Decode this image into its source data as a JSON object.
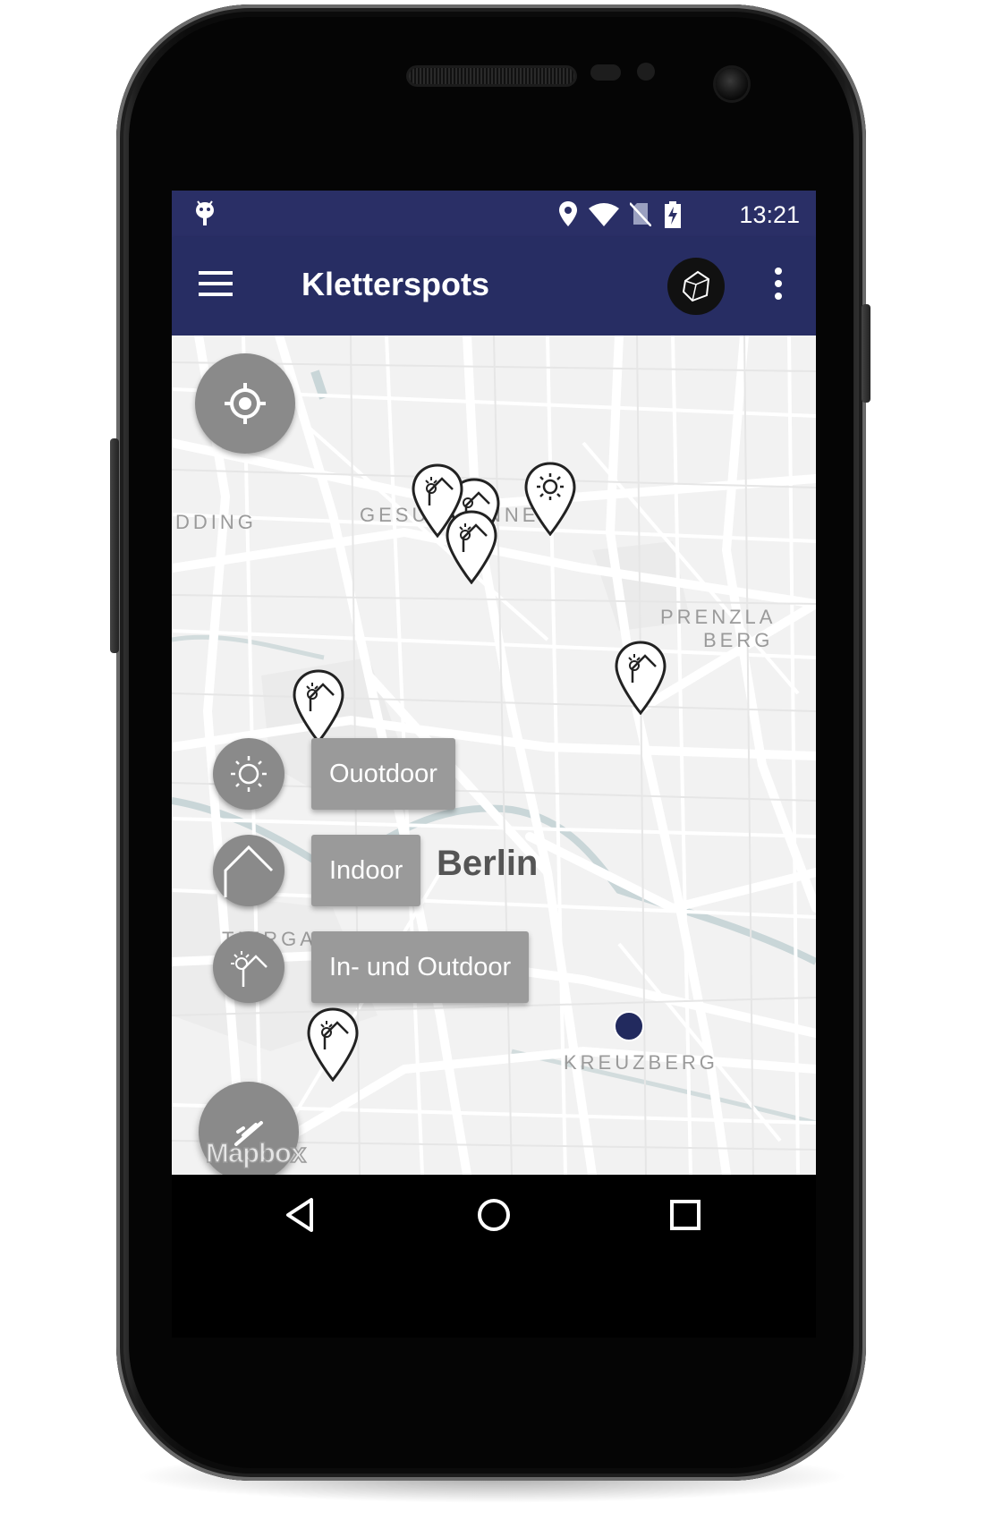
{
  "status_bar": {
    "time": "13:21",
    "icons": [
      "android-debug-icon",
      "location-icon",
      "wifi-icon",
      "no-sim-icon",
      "battery-charging-icon"
    ]
  },
  "toolbar": {
    "title": "Kletterspots",
    "menu_icon": "hamburger-menu-icon",
    "logo_icon": "boulder-logo-icon",
    "more_icon": "more-vert-icon",
    "background": "#272d63"
  },
  "map": {
    "labels": {
      "wedding": "DDING",
      "gesundbrunnen_left": "GESU",
      "gesundbrunnen_right": "NNE",
      "prenzlauer_line1": "PRENZLA",
      "prenzlauer_line2": "BERG",
      "tiergarten": "TIERGARTEN",
      "kreuzberg": "KREUZBERG"
    },
    "city_label": "Berlin",
    "attribution": "Mapbox",
    "markers": [
      "outdoor",
      "indoor",
      "in-und-outdoor"
    ],
    "user_location_color": "#222a5e"
  },
  "fab_menu": {
    "location_button_icon": "my-location-icon",
    "filters": [
      {
        "label": "Ouotdoor",
        "icon": "sun-icon"
      },
      {
        "label": "Indoor",
        "icon": "house-icon"
      },
      {
        "label": "In- und Outdoor",
        "icon": "sun-house-icon"
      }
    ],
    "main_button_icon": "filter-toggle-icon"
  },
  "nav_bar": {
    "back_icon": "back-triangle-icon",
    "home_icon": "home-circle-icon",
    "recents_icon": "recents-square-icon"
  }
}
